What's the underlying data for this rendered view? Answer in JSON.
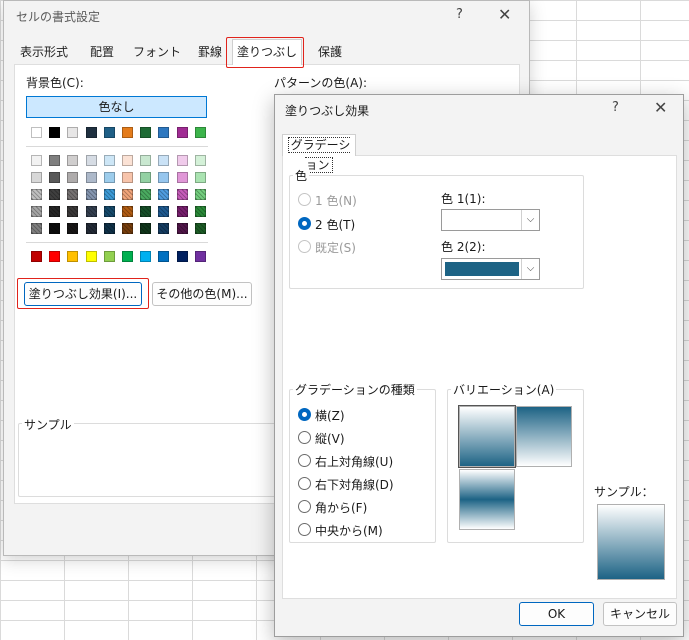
{
  "back_dialog": {
    "title": "セルの書式設定",
    "help": "?",
    "close": "✕",
    "tabs": [
      "表示形式",
      "配置",
      "フォント",
      "罫線",
      "塗りつぶし",
      "保護"
    ],
    "active_tab": "塗りつぶし",
    "background_color_label": "背景色(C):",
    "no_color_label": "色なし",
    "pattern_color_label": "パターンの色(A):",
    "fill_effects_button": "塗りつぶし効果(I)...",
    "more_colors_button": "その他の色(M)...",
    "sample_label": "サンプル"
  },
  "palette": {
    "theme_row": [
      "#ffffff",
      "#000000",
      "#e7e6e6",
      "#1f3040",
      "#1f5f86",
      "#e47c1b",
      "#1e6b35",
      "#2e78c0",
      "#a02b93",
      "#3cb44b"
    ],
    "tint_rows": [
      [
        "#f2f2f2",
        "#7f7f7f",
        "#d0cece",
        "#d6dce4",
        "#cde6f6",
        "#fbe2d5",
        "#c9e8d0",
        "#cae2f6",
        "#f0cbeb",
        "#d4f1d8"
      ],
      [
        "#d8d8d8",
        "#595959",
        "#aeabab",
        "#adb9ca",
        "#9dcdec",
        "#f7c4ab",
        "#93d1a3",
        "#96c6ee",
        "#e097d7",
        "#aae3b1"
      ],
      [
        "#bfbfbf",
        "#3f3f3f",
        "#757171",
        "#8496b0",
        "#3c9bd8",
        "#f1a47a",
        "#4aab60",
        "#4f9de0",
        "#c65bb9",
        "#73cf7e"
      ],
      [
        "#a5a5a5",
        "#262626",
        "#3a3838",
        "#333f4f",
        "#164a6b",
        "#b15c12",
        "#164f28",
        "#1e5a91",
        "#781f6e",
        "#2a8a38"
      ],
      [
        "#7f7f7f",
        "#0c0c0c",
        "#171616",
        "#222a35",
        "#0f3148",
        "#763d0c",
        "#0f351a",
        "#143c61",
        "#501549",
        "#1c5c25"
      ]
    ],
    "standard_row": [
      "#c00000",
      "#ff0000",
      "#ffc000",
      "#ffff00",
      "#92d050",
      "#00b050",
      "#00b0f0",
      "#0070c0",
      "#002060",
      "#7030a0"
    ]
  },
  "front_dialog": {
    "title": "塗りつぶし効果",
    "help": "?",
    "close": "✕",
    "tab": "グラデーション",
    "colors_group": "色",
    "radio_one_color": "1 色(N)",
    "radio_two_colors": "2 色(T)",
    "radio_preset": "既定(S)",
    "color1_label": "色 1(1):",
    "color2_label": "色 2(2):",
    "color1_value": "#ffffff",
    "color2_value": "#1d6385",
    "shading_group": "グラデーションの種類",
    "shading_styles": [
      "横(Z)",
      "縦(V)",
      "右上対角線(U)",
      "右下対角線(D)",
      "角から(F)",
      "中央から(M)"
    ],
    "selected_style": "横(Z)",
    "variants_label": "バリエーション(A)",
    "sample_label": "サンプル：",
    "ok_button": "OK",
    "cancel_button": "キャンセル"
  }
}
